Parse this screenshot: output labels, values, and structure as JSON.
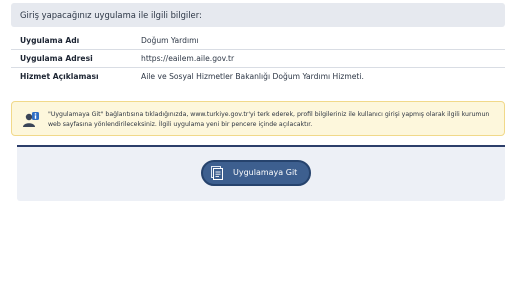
{
  "header": {
    "title": "Giriş yapacağınız uygulama ile ilgili bilgiler:"
  },
  "info": {
    "rows": [
      {
        "label": "Uygulama Adı",
        "value": "Doğum Yardımı"
      },
      {
        "label": "Uygulama Adresi",
        "value": "https://eailem.aile.gov.tr"
      },
      {
        "label": "Hizmet Açıklaması",
        "value": "Aile ve Sosyal Hizmetler Bakanlığı Doğum Yardımı Hizmeti."
      }
    ]
  },
  "notice": {
    "text": "\"Uygulamaya Git\" bağlantısına tıkladığınızda, www.turkiye.gov.tr'yi terk ederek, profil bilgileriniz ile kullanıcı girişi yapmış olarak ilgili kurumun web sayfasına yönlendirileceksiniz. İlgili uygulama yeni bir pencere içinde açılacaktır.",
    "icon": "user-info-icon"
  },
  "action": {
    "button_label": "Uygulamaya Git",
    "button_icon": "document-icon"
  },
  "colors": {
    "header_bg": "#e6e9ef",
    "notice_bg": "#fdf7dc",
    "button_bg": "#3d5f8f",
    "accent_border": "#2c3e6a"
  }
}
